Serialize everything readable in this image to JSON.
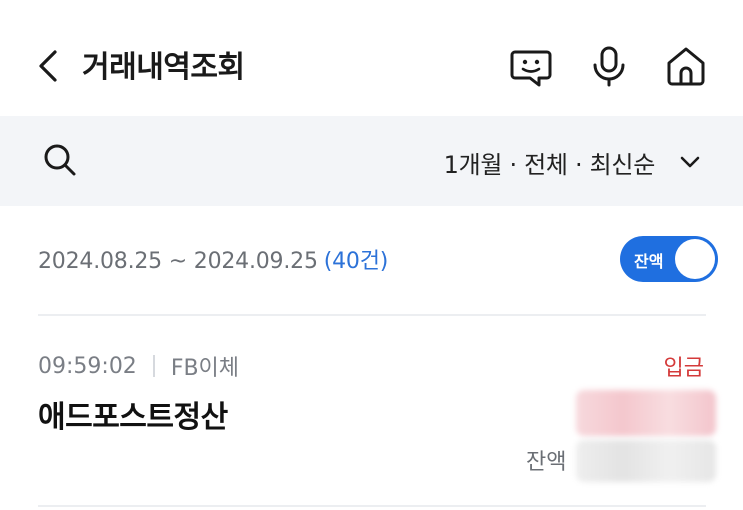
{
  "header": {
    "title": "거래내역조회",
    "icons": [
      "back-arrow-icon",
      "chat-bubble-icon",
      "microphone-icon",
      "home-icon"
    ]
  },
  "filter": {
    "summary": "1개월 · 전체 · 최신순",
    "icons": [
      "search-icon",
      "chevron-down-icon"
    ]
  },
  "period": {
    "range": "2024.08.25 ~ 2024.09.25",
    "count": "(40건)"
  },
  "balance_toggle": {
    "label": "잔액",
    "on": true,
    "accent": "#1f6fe0"
  },
  "transactions": [
    {
      "time": "09:59:02",
      "channel": "FB이체",
      "type": "입금",
      "name": "애드포스트정산",
      "balance_label": "잔액"
    }
  ],
  "colors": {
    "deposit": "#d43a3a",
    "count": "#2c72d8",
    "filter_bar_bg": "#f3f5f8"
  }
}
